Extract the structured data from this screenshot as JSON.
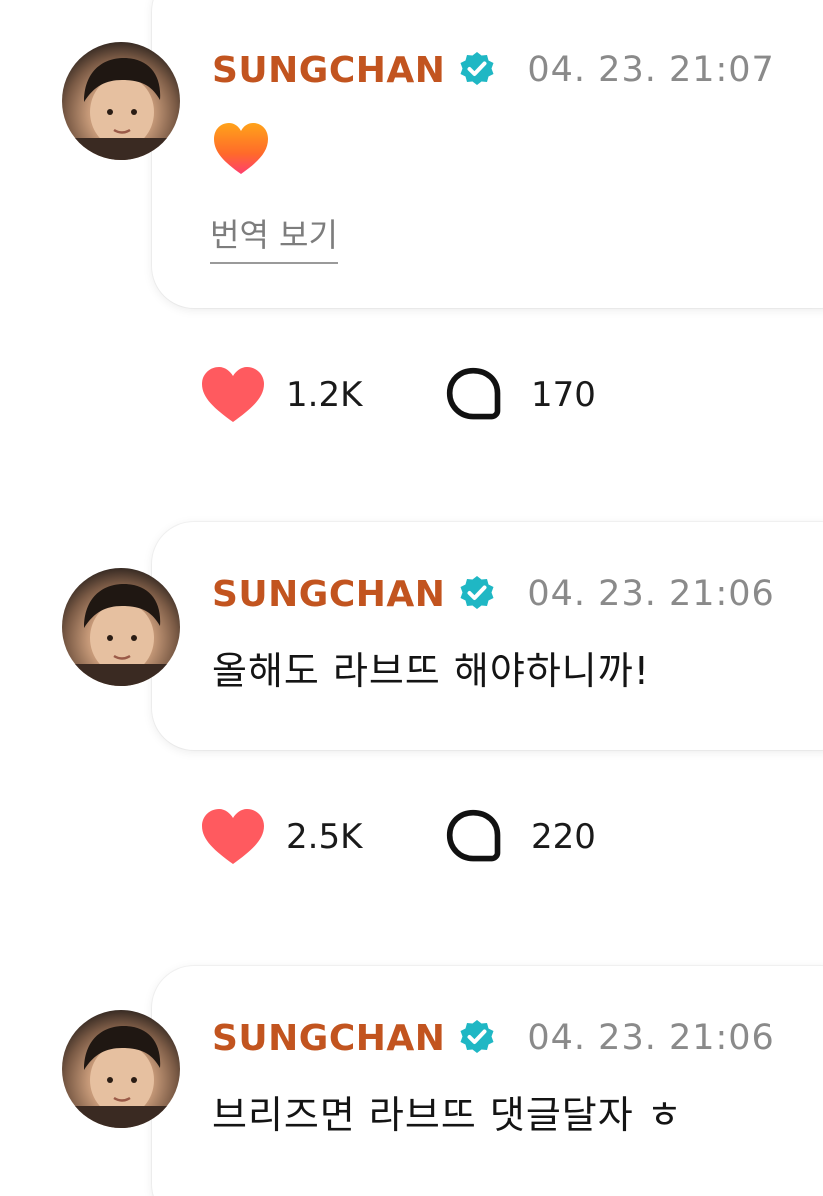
{
  "colors": {
    "author": "#c2541f",
    "verified_badge": "#1fb7c4",
    "like_heart": "#ff5a5f",
    "timestamp": "#8a8a8a"
  },
  "posts": [
    {
      "author": "SUNGCHAN",
      "verified_icon": "verified-badge-icon",
      "timestamp": "04. 23. 21:07",
      "body_emoji": "orange-heart-emoji",
      "translate_label": "번역 보기",
      "likes": "1.2K",
      "comments": "170"
    },
    {
      "author": "SUNGCHAN",
      "verified_icon": "verified-badge-icon",
      "timestamp": "04. 23. 21:06",
      "body_text": "올해도 라브뜨 해야하니까!",
      "likes": "2.5K",
      "comments": "220"
    },
    {
      "author": "SUNGCHAN",
      "verified_icon": "verified-badge-icon",
      "timestamp": "04. 23. 21:06",
      "body_text": "브리즈면 라브뜨 댓글달자 ㅎ"
    }
  ]
}
